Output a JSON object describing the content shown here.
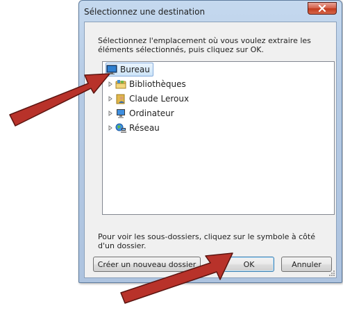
{
  "window": {
    "title": "Sélectionnez une destination",
    "close_glyph": "x"
  },
  "instructions": "Sélectionnez l'emplacement où vous voulez extraire les éléments sélectionnés, puis cliquez sur OK.",
  "tree": {
    "items": [
      {
        "label": "Bureau",
        "icon": "desktop-icon",
        "selected": true,
        "expandable": false
      },
      {
        "label": "Bibliothèques",
        "icon": "libraries-icon",
        "selected": false,
        "expandable": true
      },
      {
        "label": "Claude Leroux",
        "icon": "user-folder-icon",
        "selected": false,
        "expandable": true
      },
      {
        "label": "Ordinateur",
        "icon": "computer-icon",
        "selected": false,
        "expandable": true
      },
      {
        "label": "Réseau",
        "icon": "network-icon",
        "selected": false,
        "expandable": true
      }
    ]
  },
  "hint": "Pour voir les sous-dossiers, cliquez sur le symbole à côté d'un dossier.",
  "buttons": {
    "new_folder": "Créer un nouveau dossier",
    "ok": "OK",
    "cancel": "Annuler"
  },
  "colors": {
    "annotation_arrow": "#b8322a",
    "selection": "#cce4f8",
    "close_button": "#c7442a"
  }
}
